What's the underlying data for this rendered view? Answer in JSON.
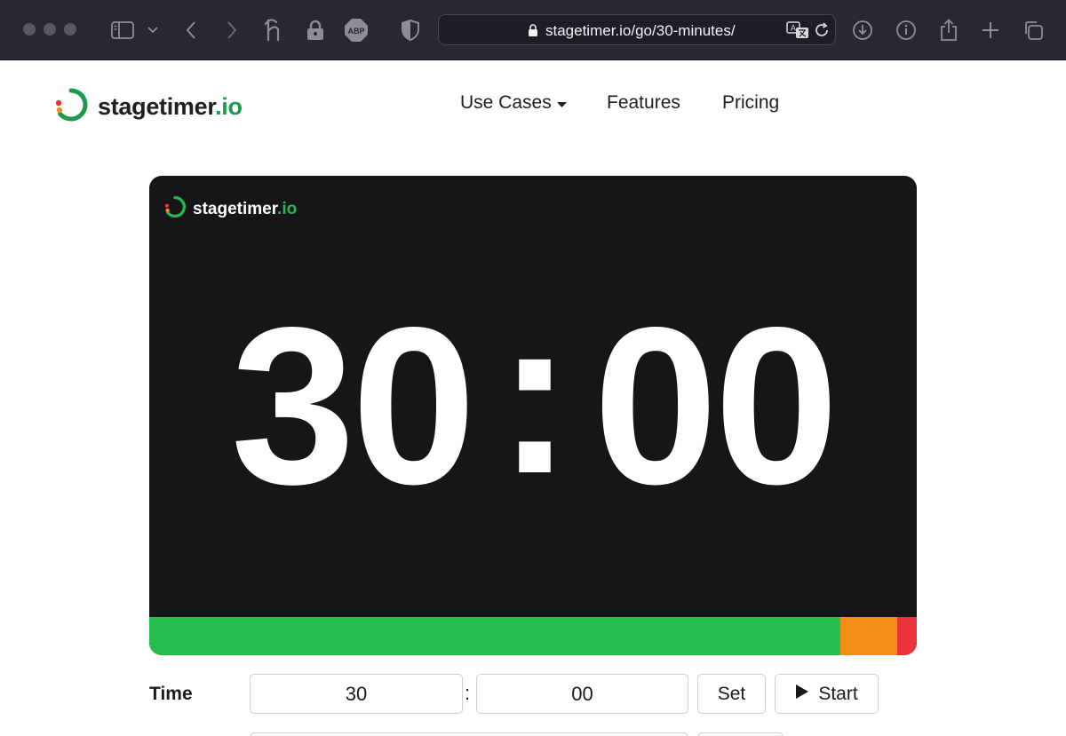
{
  "browser": {
    "url": "stagetimer.io/go/30-minutes/",
    "icons": [
      "close-dot",
      "minimize-dot",
      "zoom-dot",
      "sidebar-icon",
      "chevron-down-icon",
      "back-icon",
      "forward-icon",
      "honey-extension-icon",
      "lock-extension-icon",
      "adblock-plus-icon",
      "privacy-shield-icon",
      "lock-icon",
      "translate-icon",
      "reload-icon",
      "download-icon",
      "info-icon",
      "share-icon",
      "new-tab-icon",
      "tab-overview-icon"
    ],
    "adblock_label": "ABP"
  },
  "site": {
    "logo_name": "stagetimer",
    "logo_tld": ".io",
    "nav": {
      "use_cases": "Use Cases",
      "features": "Features",
      "pricing": "Pricing"
    }
  },
  "timer": {
    "logo_name": "stagetimer",
    "logo_tld": ".io",
    "minutes": "30",
    "colon": ":",
    "seconds": "00",
    "progress": [
      {
        "name": "green",
        "fraction": 0.9005,
        "color": "#26bf4f"
      },
      {
        "name": "orange",
        "fraction": 0.0741,
        "color": "#f28e13"
      },
      {
        "name": "red",
        "fraction": 0.0254,
        "color": "#e8343a"
      }
    ]
  },
  "controls": {
    "time_label": "Time",
    "minutes_value": "30",
    "separator": ":",
    "seconds_value": "00",
    "set_label": "Set",
    "start_label": "Start"
  },
  "colors": {
    "brand_green": "#1d9a4a",
    "timer_bg": "#171517",
    "chrome_bg": "#2a2731"
  }
}
